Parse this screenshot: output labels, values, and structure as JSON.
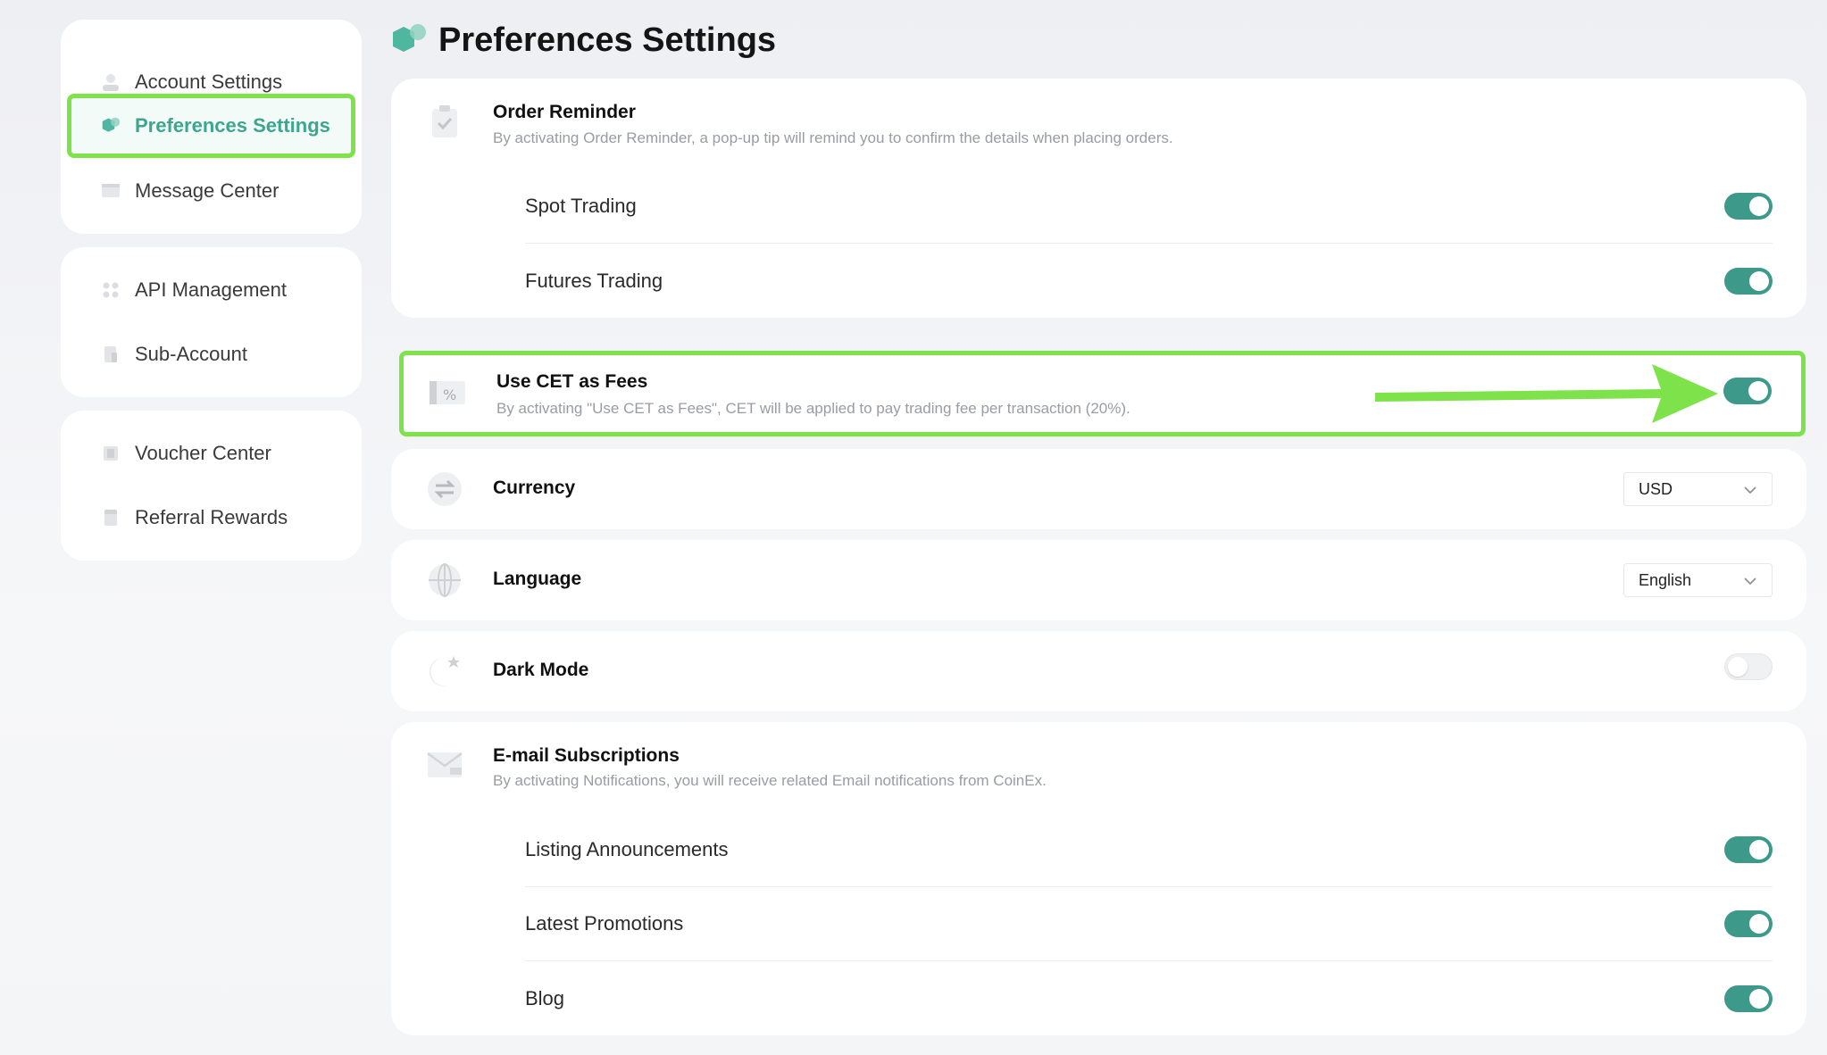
{
  "sidebar": {
    "groups": [
      {
        "items": [
          {
            "label": "Account Settings",
            "icon": "user-icon",
            "active": false
          },
          {
            "label": "Preferences Settings",
            "icon": "preferences-icon",
            "active": true
          },
          {
            "label": "Message Center",
            "icon": "message-icon",
            "active": false
          }
        ]
      },
      {
        "items": [
          {
            "label": "API Management",
            "icon": "api-icon",
            "active": false
          },
          {
            "label": "Sub-Account",
            "icon": "sub-account-icon",
            "active": false
          }
        ]
      },
      {
        "items": [
          {
            "label": "Voucher Center",
            "icon": "voucher-icon",
            "active": false
          },
          {
            "label": "Referral Rewards",
            "icon": "referral-icon",
            "active": false
          }
        ]
      }
    ]
  },
  "header": {
    "title": "Preferences Settings"
  },
  "order_reminder": {
    "title": "Order Reminder",
    "desc": "By activating Order Reminder, a pop-up tip will remind you to confirm the details when placing orders.",
    "items": [
      {
        "label": "Spot Trading",
        "enabled": true
      },
      {
        "label": "Futures Trading",
        "enabled": true
      }
    ]
  },
  "cet_fees": {
    "title": "Use CET as Fees",
    "desc": "By activating \"Use CET as Fees\", CET will be applied to pay trading fee per transaction (20%).",
    "enabled": true
  },
  "currency": {
    "title": "Currency",
    "value": "USD"
  },
  "language": {
    "title": "Language",
    "value": "English"
  },
  "dark_mode": {
    "title": "Dark Mode",
    "enabled": false
  },
  "email_subscriptions": {
    "title": "E-mail Subscriptions",
    "desc": "By activating Notifications, you will receive related Email notifications from CoinEx.",
    "items": [
      {
        "label": "Listing Announcements",
        "enabled": true
      },
      {
        "label": "Latest Promotions",
        "enabled": true
      },
      {
        "label": "Blog",
        "enabled": true
      }
    ]
  },
  "colors": {
    "accent": "#3d9a8b",
    "highlight": "#7ee24a",
    "active_text": "#3ea68e"
  }
}
